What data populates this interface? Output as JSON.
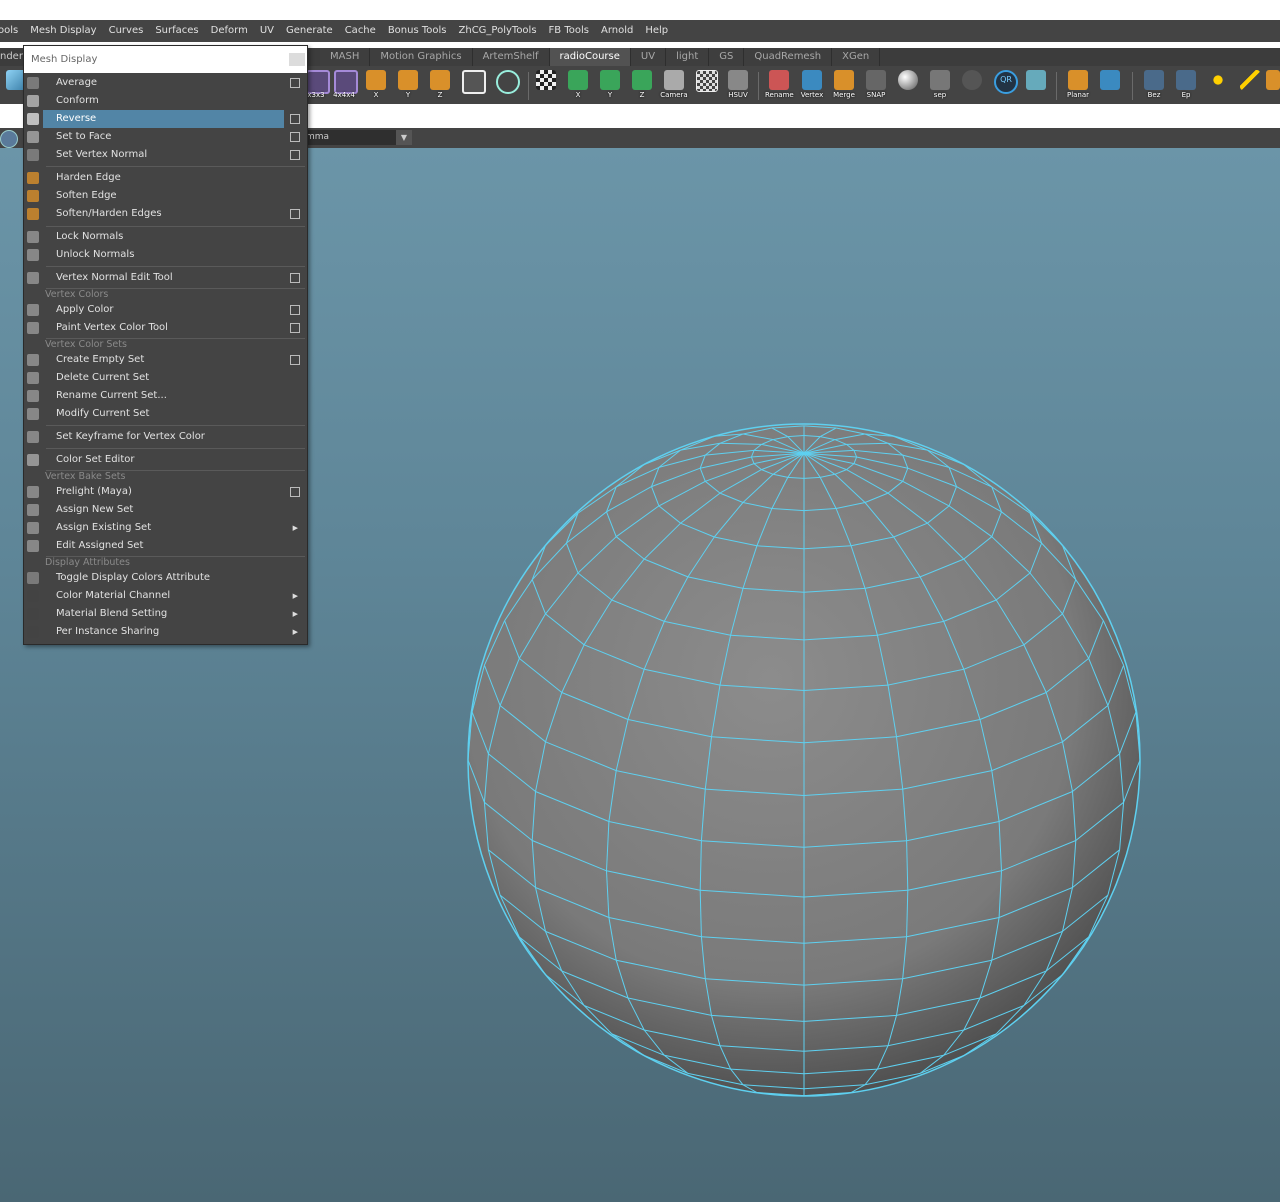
{
  "menubar": {
    "items": [
      "ools",
      "Mesh Display",
      "Curves",
      "Surfaces",
      "Deform",
      "UV",
      "Generate",
      "Cache",
      "Bonus Tools",
      "ZhCG_PolyTools",
      "FB Tools",
      "Arnold",
      "Help"
    ]
  },
  "shelf": {
    "lead_text": "nder",
    "tabs": [
      "MASH",
      "Motion Graphics",
      "ArtemShelf",
      "radioCourse",
      "UV",
      "light",
      "GS",
      "QuadRemesh",
      "XGen"
    ],
    "active_tab": "radioCourse",
    "icon_labels": {
      "x3x3": "x3x3",
      "x4x4": "4x4x4",
      "x": "X",
      "y": "Y",
      "z": "Z",
      "xs": "X",
      "ys": "Y",
      "zs": "Z",
      "camera": "Camera",
      "hsuv": "HSUV",
      "rename": "Rename",
      "vertex": "Vertex",
      "merge": "Merge",
      "snap": "SNAP",
      "sep": "sep",
      "qr": "QR",
      "planar": "Planar",
      "bez": "Bez",
      "ep": "Ep"
    }
  },
  "toolrow": {
    "camera_field": "mma"
  },
  "menu": {
    "title": "Mesh Display",
    "items": [
      {
        "label": "Average",
        "option": true
      },
      {
        "label": "Conform",
        "option": false
      },
      {
        "label": "Reverse",
        "option": true,
        "highlighted": true
      },
      {
        "label": "Set to Face",
        "option": true
      },
      {
        "label": "Set Vertex Normal",
        "option": true
      },
      {
        "label": "Harden Edge",
        "option": false
      },
      {
        "label": "Soften Edge",
        "option": false
      },
      {
        "label": "Soften/Harden Edges",
        "option": true
      },
      {
        "label": "Lock Normals",
        "option": false
      },
      {
        "label": "Unlock Normals",
        "option": false
      },
      {
        "label": "Vertex Normal Edit Tool",
        "option": true
      },
      {
        "label": "Apply Color",
        "option": true
      },
      {
        "label": "Paint Vertex Color Tool",
        "option": true
      },
      {
        "label": "Create Empty Set",
        "option": true
      },
      {
        "label": "Delete Current Set",
        "option": false
      },
      {
        "label": "Rename Current Set...",
        "option": false
      },
      {
        "label": "Modify Current Set",
        "option": false
      },
      {
        "label": "Set Keyframe for Vertex Color",
        "option": false
      },
      {
        "label": "Color Set Editor",
        "option": false
      },
      {
        "label": "Prelight (Maya)",
        "option": true
      },
      {
        "label": "Assign New Set",
        "option": false
      },
      {
        "label": "Assign Existing Set",
        "submenu": true
      },
      {
        "label": "Edit Assigned Set",
        "option": false
      },
      {
        "label": "Toggle Display Colors Attribute",
        "option": false
      },
      {
        "label": "Color Material Channel",
        "submenu": true
      },
      {
        "label": "Material Blend Setting",
        "submenu": true
      },
      {
        "label": "Per Instance Sharing",
        "submenu": true
      }
    ],
    "sections": [
      "Vertex Colors",
      "Vertex Color Sets",
      "Vertex Bake Sets",
      "Display Attributes"
    ]
  },
  "colors": {
    "ui_bg": "#444444",
    "highlight": "#5285a6",
    "wireframe": "#5ed0f0",
    "viewport_top": "#6b95a8",
    "viewport_bottom": "#4a6774"
  }
}
